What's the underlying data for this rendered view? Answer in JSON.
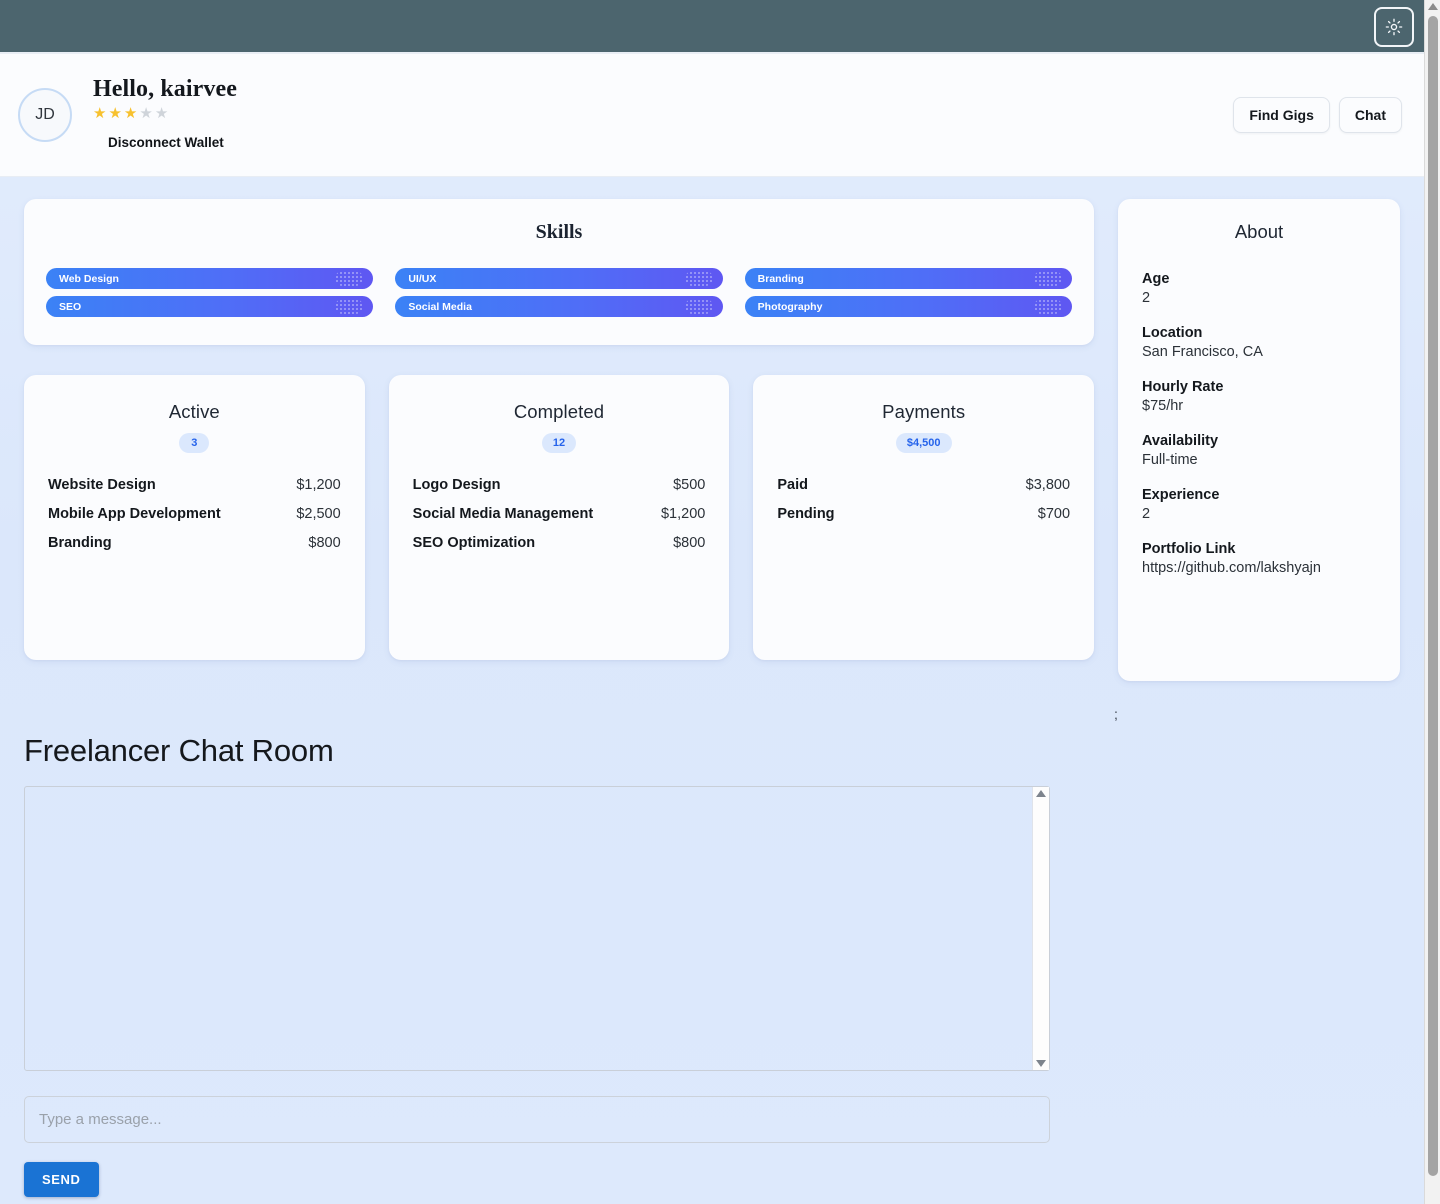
{
  "topbar": {
    "theme_toggle_icon": "sun-icon"
  },
  "header": {
    "avatar_initials": "JD",
    "greeting": "Hello, kairvee",
    "rating_filled": 3,
    "rating_total": 5,
    "disconnect_label": "Disconnect Wallet",
    "find_gigs_label": "Find Gigs",
    "chat_label": "Chat"
  },
  "skills": {
    "title": "Skills",
    "items": [
      {
        "label": "Web Design"
      },
      {
        "label": "UI/UX"
      },
      {
        "label": "Branding"
      },
      {
        "label": "SEO"
      },
      {
        "label": "Social Media"
      },
      {
        "label": "Photography"
      }
    ]
  },
  "stats": [
    {
      "title": "Active",
      "badge": "3",
      "items": [
        {
          "label": "Website Design",
          "value": "$1,200"
        },
        {
          "label": "Mobile App Development",
          "value": "$2,500"
        },
        {
          "label": "Branding",
          "value": "$800"
        }
      ]
    },
    {
      "title": "Completed",
      "badge": "12",
      "items": [
        {
          "label": "Logo Design",
          "value": "$500"
        },
        {
          "label": "Social Media Management",
          "value": "$1,200"
        },
        {
          "label": "SEO Optimization",
          "value": "$800"
        }
      ]
    },
    {
      "title": "Payments",
      "badge": "$4,500",
      "items": [
        {
          "label": "Paid",
          "value": "$3,800"
        },
        {
          "label": "Pending",
          "value": "$700"
        }
      ]
    }
  ],
  "about": {
    "title": "About",
    "items": [
      {
        "label": "Age",
        "value": "2"
      },
      {
        "label": "Location",
        "value": "San Francisco, CA"
      },
      {
        "label": "Hourly Rate",
        "value": "$75/hr"
      },
      {
        "label": "Availability",
        "value": "Full-time"
      },
      {
        "label": "Experience",
        "value": "2"
      },
      {
        "label": "Portfolio Link",
        "value": "https://github.com/lakshyajn"
      }
    ]
  },
  "stray_text": ";",
  "chat": {
    "title": "Freelancer Chat Room",
    "messages_value": "",
    "input_value": "",
    "input_placeholder": "Type a message...",
    "send_label": "SEND"
  },
  "colors": {
    "topbar": "#4c656e",
    "accent_blue": "#2563eb",
    "send_blue": "#1a73d4",
    "star_gold": "#f7c12f",
    "star_gray": "#cfd4da",
    "page_bg": "#dde9fc"
  }
}
